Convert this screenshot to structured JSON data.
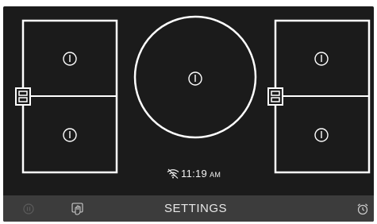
{
  "status": {
    "wifi_icon": "wifi-off-icon",
    "time": "11:19",
    "ampm": "AM"
  },
  "cooktop": {
    "zones": [
      {
        "name": "left-front",
        "state": "off",
        "icon": "power-icon"
      },
      {
        "name": "left-rear",
        "state": "off",
        "icon": "power-icon"
      },
      {
        "name": "center",
        "state": "off",
        "icon": "power-icon"
      },
      {
        "name": "right-front",
        "state": "off",
        "icon": "power-icon"
      },
      {
        "name": "right-rear",
        "state": "off",
        "icon": "power-icon"
      }
    ],
    "bridge_icons": [
      "bridge-left-icon",
      "bridge-right-icon"
    ]
  },
  "bottom_bar": {
    "pause_icon": "pause-icon",
    "lock_icon": "hand-lock-icon",
    "settings_label": "SETTINGS",
    "timer_icon": "alarm-clock-icon"
  },
  "colors": {
    "screen_bg": "#1b1b1b",
    "outline": "#ffffff",
    "bottom_bar": "#3c3c3c",
    "muted_icon": "#5c5c5c"
  }
}
